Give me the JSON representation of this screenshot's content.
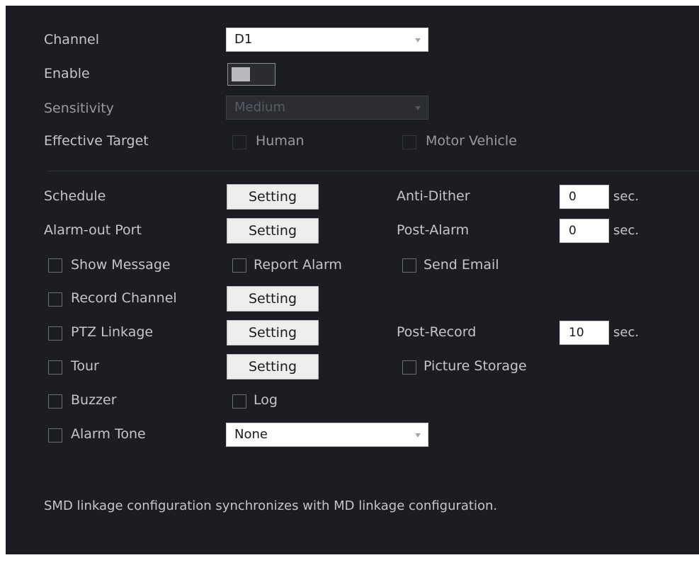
{
  "fields": {
    "channel": {
      "label": "Channel",
      "value": "D1"
    },
    "enable": {
      "label": "Enable",
      "on": false
    },
    "sensitivity": {
      "label": "Sensitivity",
      "value": "Medium"
    },
    "effective_target": {
      "label": "Effective Target",
      "options": [
        "Human",
        "Motor Vehicle"
      ]
    },
    "schedule": {
      "label": "Schedule",
      "button": "Setting"
    },
    "anti_dither": {
      "label": "Anti-Dither",
      "value": "0",
      "unit": "sec."
    },
    "alarm_out_port": {
      "label": "Alarm-out Port",
      "button": "Setting"
    },
    "post_alarm": {
      "label": "Post-Alarm",
      "value": "0",
      "unit": "sec."
    },
    "show_message": {
      "label": "Show Message"
    },
    "report_alarm": {
      "label": "Report Alarm"
    },
    "send_email": {
      "label": "Send Email"
    },
    "record_channel": {
      "label": "Record Channel",
      "button": "Setting"
    },
    "ptz_linkage": {
      "label": "PTZ Linkage",
      "button": "Setting"
    },
    "post_record": {
      "label": "Post-Record",
      "value": "10",
      "unit": "sec."
    },
    "tour": {
      "label": "Tour",
      "button": "Setting"
    },
    "picture_storage": {
      "label": "Picture Storage"
    },
    "buzzer": {
      "label": "Buzzer"
    },
    "log": {
      "label": "Log"
    },
    "alarm_tone": {
      "label": "Alarm Tone",
      "value": "None"
    }
  },
  "note": "SMD linkage configuration synchronizes with MD linkage configuration."
}
